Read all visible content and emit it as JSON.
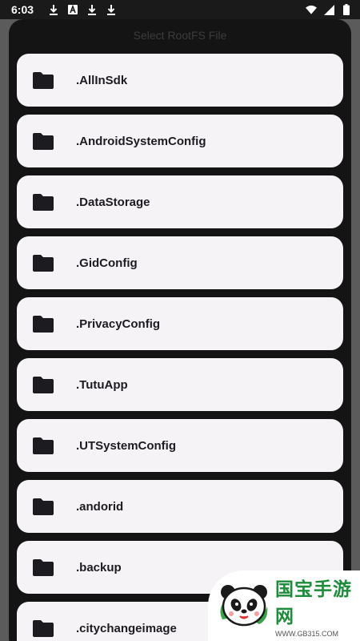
{
  "status_bar": {
    "time": "6:03",
    "icons": [
      "download-icon",
      "a-badge-icon",
      "download-icon",
      "download-icon"
    ],
    "right_icons": [
      "wifi-icon",
      "signal-icon",
      "battery-icon"
    ]
  },
  "dialog": {
    "title": "Select RootFS File",
    "items": [
      {
        "name": ".AllInSdk",
        "icon": "folder-icon"
      },
      {
        "name": ".AndroidSystemConfig",
        "icon": "folder-icon"
      },
      {
        "name": ".DataStorage",
        "icon": "folder-icon"
      },
      {
        "name": ".GidConfig",
        "icon": "folder-icon"
      },
      {
        "name": ".PrivacyConfig",
        "icon": "folder-icon"
      },
      {
        "name": ".TutuApp",
        "icon": "folder-icon"
      },
      {
        "name": ".UTSystemConfig",
        "icon": "folder-icon"
      },
      {
        "name": ".andorid",
        "icon": "folder-icon"
      },
      {
        "name": ".backup",
        "icon": "folder-icon"
      },
      {
        "name": ".citychangeimage",
        "icon": "folder-icon"
      }
    ]
  },
  "watermark": {
    "brand": "国宝手游网",
    "url": "WWW.GB315.COM"
  },
  "colors": {
    "dialog_bg": "#141414",
    "item_bg": "#f6f3f7",
    "item_text": "#1c1b1f",
    "brand_green": "#1c8c3a"
  }
}
